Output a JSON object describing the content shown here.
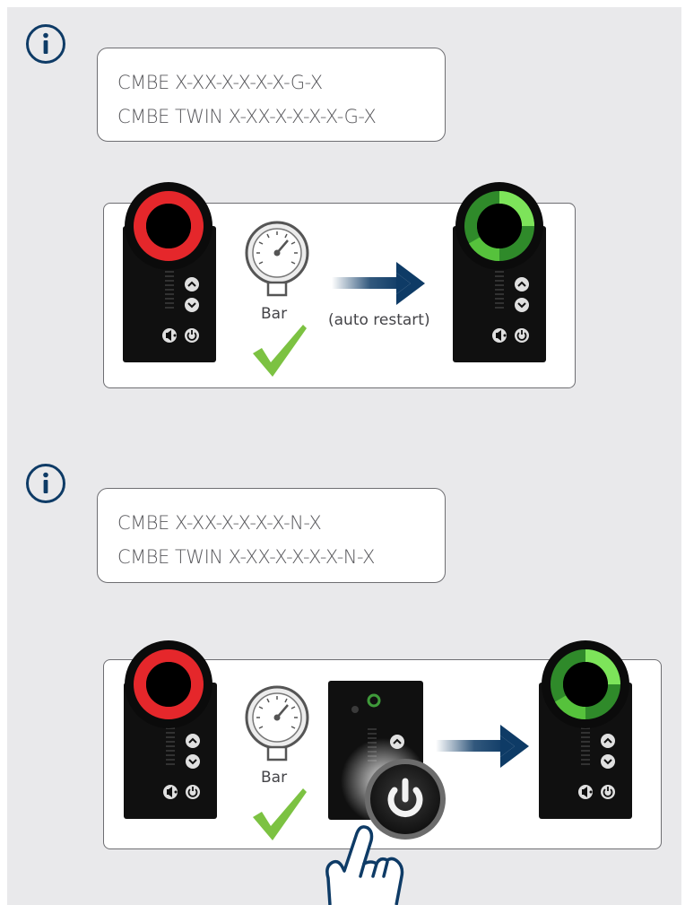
{
  "colors": {
    "background": "#e9e9eb",
    "accent": "#0e3b66",
    "fault_ring": "#e5272b",
    "ok_ring": "#5cc33d",
    "check": "#7cc242"
  },
  "section1": {
    "icon": "info-icon",
    "code_lines": [
      "CMBE X-XX-X-X-X-X-G-X",
      "CMBE TWIN X-XX-X-X-X-X-G-X"
    ],
    "gauge_label": "Bar",
    "arrow_label": "(auto restart)"
  },
  "section2": {
    "icon": "info-icon",
    "code_lines": [
      "CMBE X-XX-X-X-X-X-N-X",
      "CMBE TWIN X-XX-X-X-X-X-N-X"
    ],
    "gauge_label": "Bar",
    "press_icon": "hand-pointer-icon",
    "button_icon": "power-icon"
  }
}
